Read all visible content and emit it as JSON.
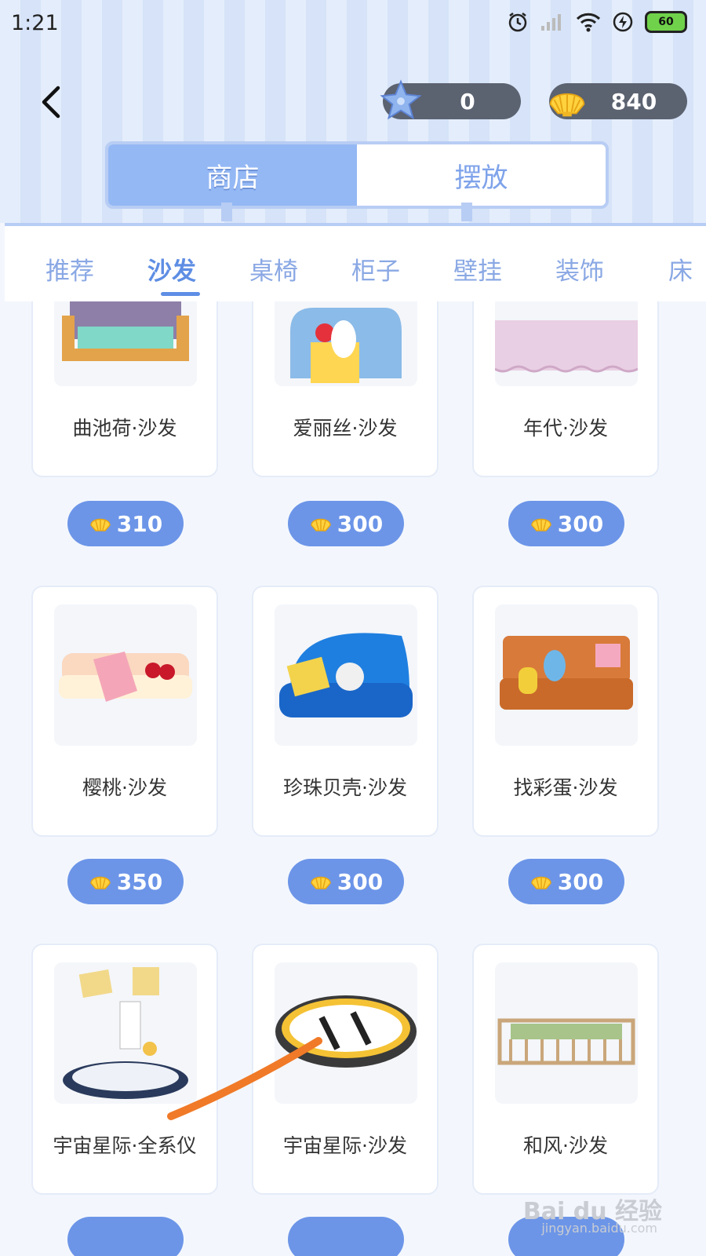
{
  "status_bar": {
    "time": "1:21",
    "battery": "60"
  },
  "currencies": {
    "star_value": "0",
    "shell_value": "840"
  },
  "segment": {
    "shop": "商店",
    "place": "摆放"
  },
  "categories": [
    "推荐",
    "沙发",
    "桌椅",
    "柜子",
    "壁挂",
    "装饰",
    "床"
  ],
  "active_category": "沙发",
  "items": [
    {
      "name": "曲池荷·沙发",
      "price": "310"
    },
    {
      "name": "爱丽丝·沙发",
      "price": "300"
    },
    {
      "name": "年代·沙发",
      "price": "300"
    },
    {
      "name": "樱桃·沙发",
      "price": "350"
    },
    {
      "name": "珍珠贝壳·沙发",
      "price": "300"
    },
    {
      "name": "找彩蛋·沙发",
      "price": "300"
    },
    {
      "name": "宇宙星际·全系仪",
      "price": ""
    },
    {
      "name": "宇宙星际·沙发",
      "price": ""
    },
    {
      "name": "和风·沙发",
      "price": ""
    }
  ],
  "watermark": {
    "main": "Bai du 经验",
    "sub": "jingyan.baidu.com"
  },
  "colors": {
    "accent": "#6c95e8",
    "tab_active": "#94b8f4",
    "header_stripe": "#d6e3f8"
  }
}
